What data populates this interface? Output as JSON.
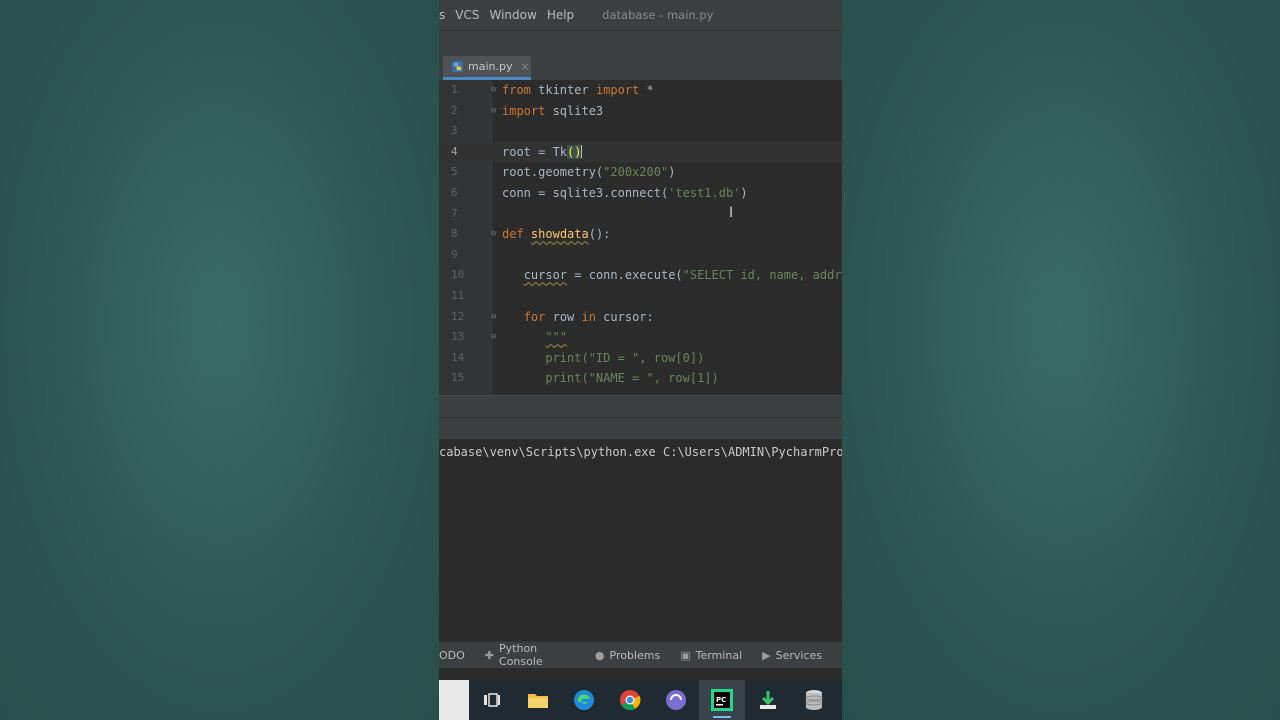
{
  "menubar": {
    "items": [
      "s",
      "VCS",
      "Window",
      "Help"
    ],
    "window_title": "database - main.py"
  },
  "tab": {
    "label": "main.py",
    "close": "×"
  },
  "editor": {
    "lines": [
      {
        "n": "1",
        "html": "<span class=\"kw\">from</span> tkinter <span class=\"kw\">import</span> *"
      },
      {
        "n": "2",
        "html": "<span class=\"kw\">import</span> sqlite3"
      },
      {
        "n": "3",
        "html": ""
      },
      {
        "n": "4",
        "html": "root = Tk<span class=\"mismatch\">()</span><span class=\"cursor-bar\"></span>"
      },
      {
        "n": "5",
        "html": "root.geometry(<span class=\"str\">\"200x200\"</span>)"
      },
      {
        "n": "6",
        "html": "conn = sqlite3.connect(<span class=\"str\">'test1.db'</span>)"
      },
      {
        "n": "7",
        "html": ""
      },
      {
        "n": "8",
        "html": "<span class=\"kw\">def</span> <span class=\"fn warn\">showdata</span>():"
      },
      {
        "n": "9",
        "html": ""
      },
      {
        "n": "10",
        "html": "   <span class=\"warn\">cursor</span> = conn.execute(<span class=\"str\">\"SELECT id, name, address from</span>"
      },
      {
        "n": "11",
        "html": ""
      },
      {
        "n": "12",
        "html": "   <span class=\"kw\">for</span> row <span class=\"kw\">in</span> cursor:"
      },
      {
        "n": "13",
        "html": "      <span class=\"str warn\">\"\"\"</span>"
      },
      {
        "n": "14",
        "html": "      <span class=\"str\">print(\"ID = \", row[0])</span>"
      },
      {
        "n": "15",
        "html": "      <span class=\"str\">print(\"NAME = \", row[1])</span>"
      }
    ]
  },
  "console": {
    "command": "cabase\\venv\\Scripts\\python.exe C:\\Users\\ADMIN\\PycharmProjects"
  },
  "toolstrip": {
    "todo": "ODO",
    "python_console": "Python Console",
    "problems": "Problems",
    "terminal": "Terminal",
    "services": "Services"
  }
}
